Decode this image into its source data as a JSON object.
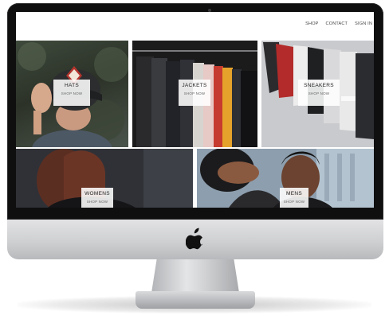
{
  "nav": {
    "shop": "SHOP",
    "contact": "CONTACT",
    "sign_in": "SIGN IN"
  },
  "tiles": [
    {
      "title": "HATS",
      "subtitle": "SHOP NOW"
    },
    {
      "title": "JACKETS",
      "subtitle": "SHOP NOW"
    },
    {
      "title": "SNEAKERS",
      "subtitle": "SHOP NOW"
    },
    {
      "title": "WOMENS",
      "subtitle": "SHOP NOW"
    },
    {
      "title": "MENS",
      "subtitle": "SHOP NOW"
    }
  ],
  "colors": {
    "bezel": "#0f0f10",
    "chin": "#cfd0d2",
    "screen_bg": "#ffffff",
    "label_bg": "#ffffff"
  },
  "icons": {
    "apple_logo": "apple-logo-icon",
    "camera": "camera-icon"
  }
}
